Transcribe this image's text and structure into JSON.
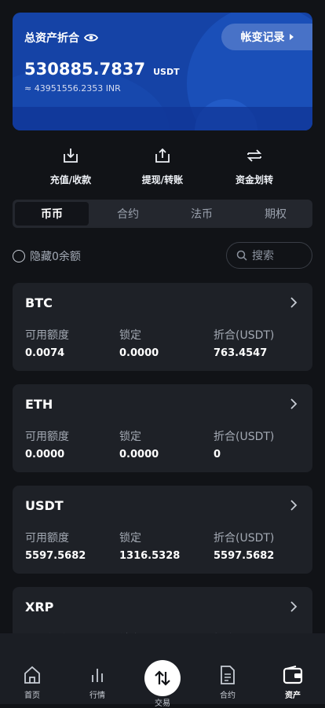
{
  "banner": {
    "title": "总资产折合",
    "ledger_label": "帐变记录",
    "total_value": "530885.7837",
    "total_unit": "USDT",
    "approx_text": "≈ 43951556.2353 INR"
  },
  "actions": [
    {
      "label": "充值/收款",
      "icon": "download-icon"
    },
    {
      "label": "提现/转账",
      "icon": "upload-icon"
    },
    {
      "label": "资金划转",
      "icon": "transfer-icon"
    }
  ],
  "tabs": [
    "币币",
    "合约",
    "法币",
    "期权"
  ],
  "filter": {
    "hide_zero_label": "隐藏0余额",
    "search_placeholder": "搜索"
  },
  "columns": {
    "available": "可用额度",
    "locked": "锁定",
    "equivalent": "折合(USDT)"
  },
  "coins": [
    {
      "name": "BTC",
      "available": "0.0074",
      "locked": "0.0000",
      "equivalent": "763.4547"
    },
    {
      "name": "ETH",
      "available": "0.0000",
      "locked": "0.0000",
      "equivalent": "0"
    },
    {
      "name": "USDT",
      "available": "5597.5682",
      "locked": "1316.5328",
      "equivalent": "5597.5682"
    },
    {
      "name": "XRP",
      "available": "",
      "locked": "",
      "equivalent": ""
    }
  ],
  "nav": {
    "home": "首页",
    "market": "行情",
    "trade": "交易",
    "contract": "合约",
    "assets": "资产"
  },
  "colors": {
    "banner": "#1543a6",
    "background": "#111317",
    "card": "#1e2127"
  }
}
